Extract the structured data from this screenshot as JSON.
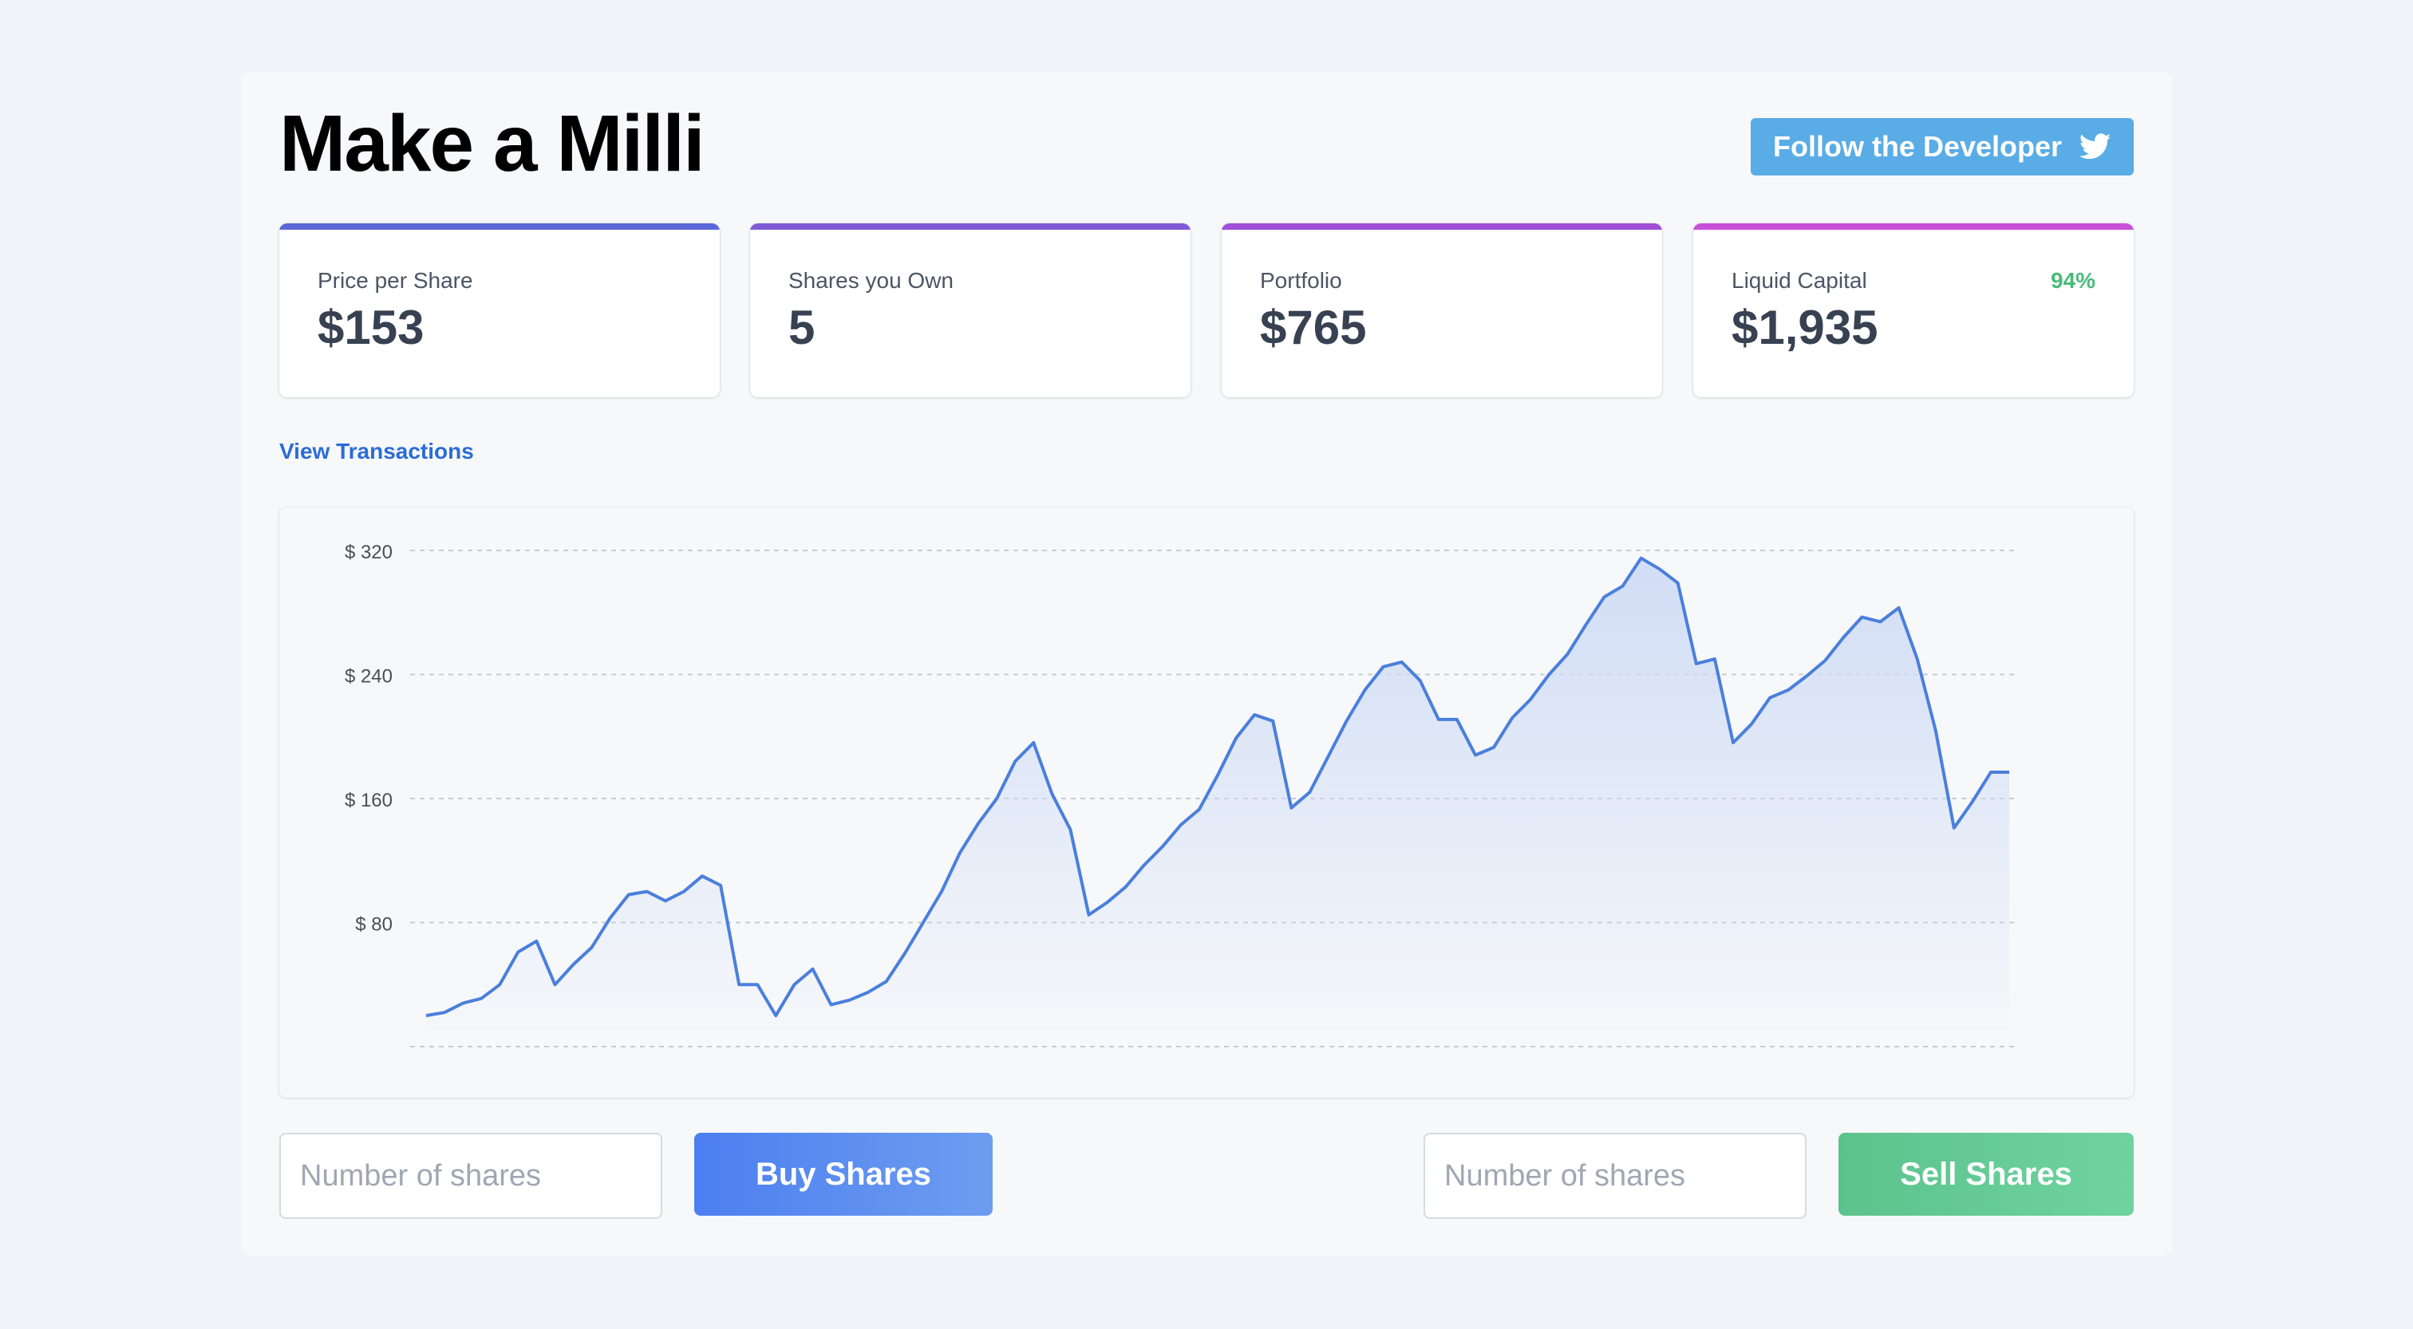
{
  "header": {
    "title": "Make a Milli",
    "follow_label": "Follow the Developer",
    "follow_icon": "twitter-icon"
  },
  "stats": [
    {
      "label": "Price per Share",
      "value": "$153",
      "accent": "#5a67d8"
    },
    {
      "label": "Shares you Own",
      "value": "5",
      "accent": "#805ad5"
    },
    {
      "label": "Portfolio",
      "value": "$765",
      "accent": "#9f4fd8"
    },
    {
      "label": "Liquid Capital",
      "value": "$1,935",
      "accent": "#c84fd8",
      "badge": "94%"
    }
  ],
  "links": {
    "view_transactions": "View Transactions"
  },
  "chart_data": {
    "type": "area",
    "title": "",
    "xlabel": "",
    "ylabel": "",
    "ylim": [
      0,
      320
    ],
    "yticks": [
      80,
      160,
      240,
      320
    ],
    "ytick_labels": [
      "$ 80",
      "$ 160",
      "$ 240",
      "$ 320"
    ],
    "grid": true,
    "line_color": "#4a7fdc",
    "fill_color": "#cfdcf5",
    "values": [
      20,
      22,
      28,
      31,
      40,
      61,
      68,
      40,
      53,
      64,
      83,
      98,
      100,
      94,
      100,
      110,
      104,
      40,
      40,
      20,
      40,
      50,
      27,
      30,
      35,
      42,
      60,
      80,
      100,
      125,
      144,
      160,
      184,
      196,
      163,
      140,
      85,
      93,
      103,
      117,
      129,
      143,
      153,
      175,
      199,
      214,
      210,
      154,
      164,
      187,
      210,
      230,
      245,
      248,
      236,
      211,
      211,
      188,
      193,
      212,
      224,
      240,
      253,
      272,
      290,
      297,
      315,
      308,
      299,
      247,
      250,
      196,
      208,
      225,
      230,
      239,
      249,
      264,
      277,
      274,
      283,
      250,
      204,
      141,
      158,
      177,
      177
    ]
  },
  "trade": {
    "buy_placeholder": "Number of shares",
    "buy_label": "Buy Shares",
    "sell_placeholder": "Number of shares",
    "sell_label": "Sell Shares"
  }
}
